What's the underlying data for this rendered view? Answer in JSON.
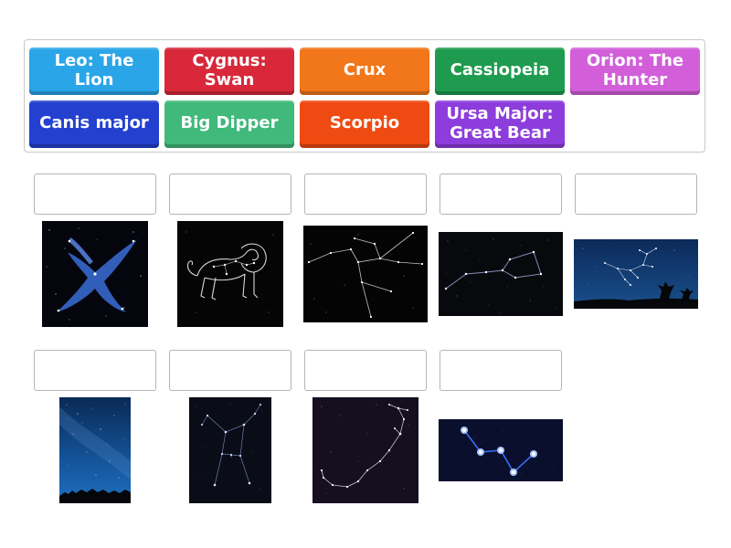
{
  "tiles": [
    {
      "label": "Leo: The Lion",
      "color": "#2aa6e8"
    },
    {
      "label": "Cygnus: Swan",
      "color": "#d8283a"
    },
    {
      "label": "Crux",
      "color": "#f2761a"
    },
    {
      "label": "Cassiopeia",
      "color": "#1e9b4f"
    },
    {
      "label": "Orion: The Hunter",
      "color": "#d25fd9"
    },
    {
      "label": "Canis major",
      "color": "#2340cf"
    },
    {
      "label": "Big Dipper",
      "color": "#40b97a"
    },
    {
      "label": "Scorpio",
      "color": "#ef4a12"
    },
    {
      "label": "Ursa Major: Great Bear",
      "color": "#8d3ddc"
    }
  ],
  "images": [
    {
      "icon": "cygnus-swan-constellation-image"
    },
    {
      "icon": "leo-lion-constellation-image"
    },
    {
      "icon": "ursa-major-constellation-image"
    },
    {
      "icon": "big-dipper-constellation-image"
    },
    {
      "icon": "orion-night-landscape-image"
    },
    {
      "icon": "milky-way-sky-image"
    },
    {
      "icon": "orion-constellation-image"
    },
    {
      "icon": "scorpio-constellation-image"
    },
    {
      "icon": "cassiopeia-blue-stars-image"
    }
  ]
}
